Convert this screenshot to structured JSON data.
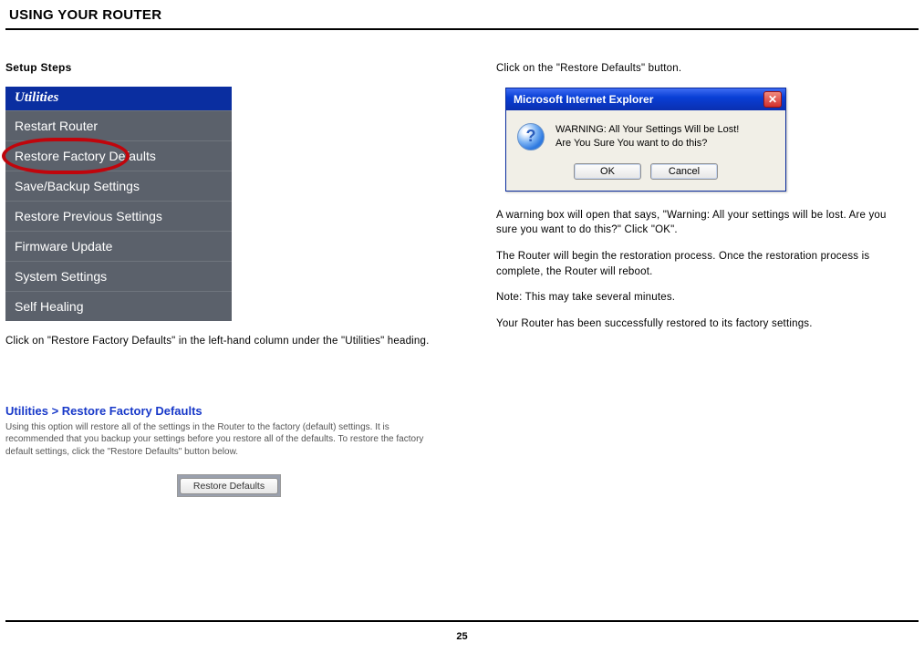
{
  "header": "USING YOUR ROUTER",
  "page_number": "25",
  "left": {
    "title": "Setup Steps",
    "utilities_header": "Utilities",
    "menu": [
      "Restart Router",
      "Restore Factory Defaults",
      "Save/Backup Settings",
      "Restore Previous Settings",
      "Firmware Update",
      "System Settings",
      "Self Healing"
    ],
    "caption": "Click on \"Restore Factory Defaults\" in the left-hand column under the \"Utilities\" heading.",
    "restore_breadcrumb": "Utilities > Restore Factory Defaults",
    "restore_desc": "Using this option will restore all of the settings in the Router to the factory (default) settings. It is recommended that you backup your settings before you restore all of the defaults. To restore the factory default settings, click the \"Restore Defaults\" button below.",
    "restore_btn": "Restore Defaults"
  },
  "right": {
    "intro": "Click on the \"Restore Defaults\" button.",
    "dialog_title": "Microsoft Internet Explorer",
    "dialog_msg_line1": "WARNING: All Your Settings Will be Lost!",
    "dialog_msg_line2": "Are You Sure You want to do this?",
    "ok": "OK",
    "cancel": "Cancel",
    "p1": "A warning box will open that says, \"Warning: All your settings will be lost. Are you sure you want to do this?\" Click \"OK\".",
    "p2": "The Router will begin the restoration process. Once the restoration process is complete, the Router will reboot.",
    "p3": "Note: This may take several minutes.",
    "p4": "Your Router has been successfully restored to its factory settings."
  }
}
